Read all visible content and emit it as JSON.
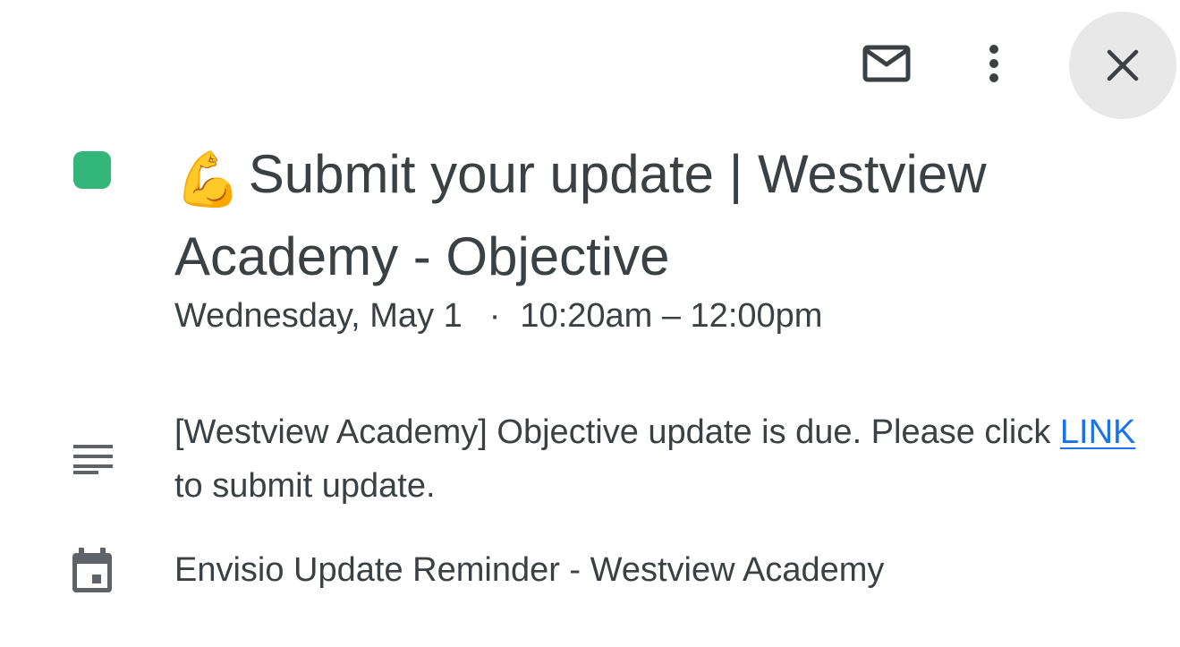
{
  "toolbar": {
    "email_icon": "email-icon",
    "more_icon": "more-vert-icon",
    "close_icon": "close-icon"
  },
  "event": {
    "color": "#33b679",
    "title_emoji": "💪",
    "title": "Submit your update | Westview Academy - Objective",
    "date": "Wednesday, May 1",
    "separator": "·",
    "time_range": "10:20am – 12:00pm",
    "description_before_link": "[Westview Academy] Objective update is due. Please click ",
    "description_link": "LINK",
    "description_after_link": " to submit update.",
    "calendar_name": "Envisio Update Reminder - Westview Academy"
  },
  "colors": {
    "link": "#1a73e8",
    "text": "#3c4043",
    "close_button_bg": "#e8e8e8"
  }
}
